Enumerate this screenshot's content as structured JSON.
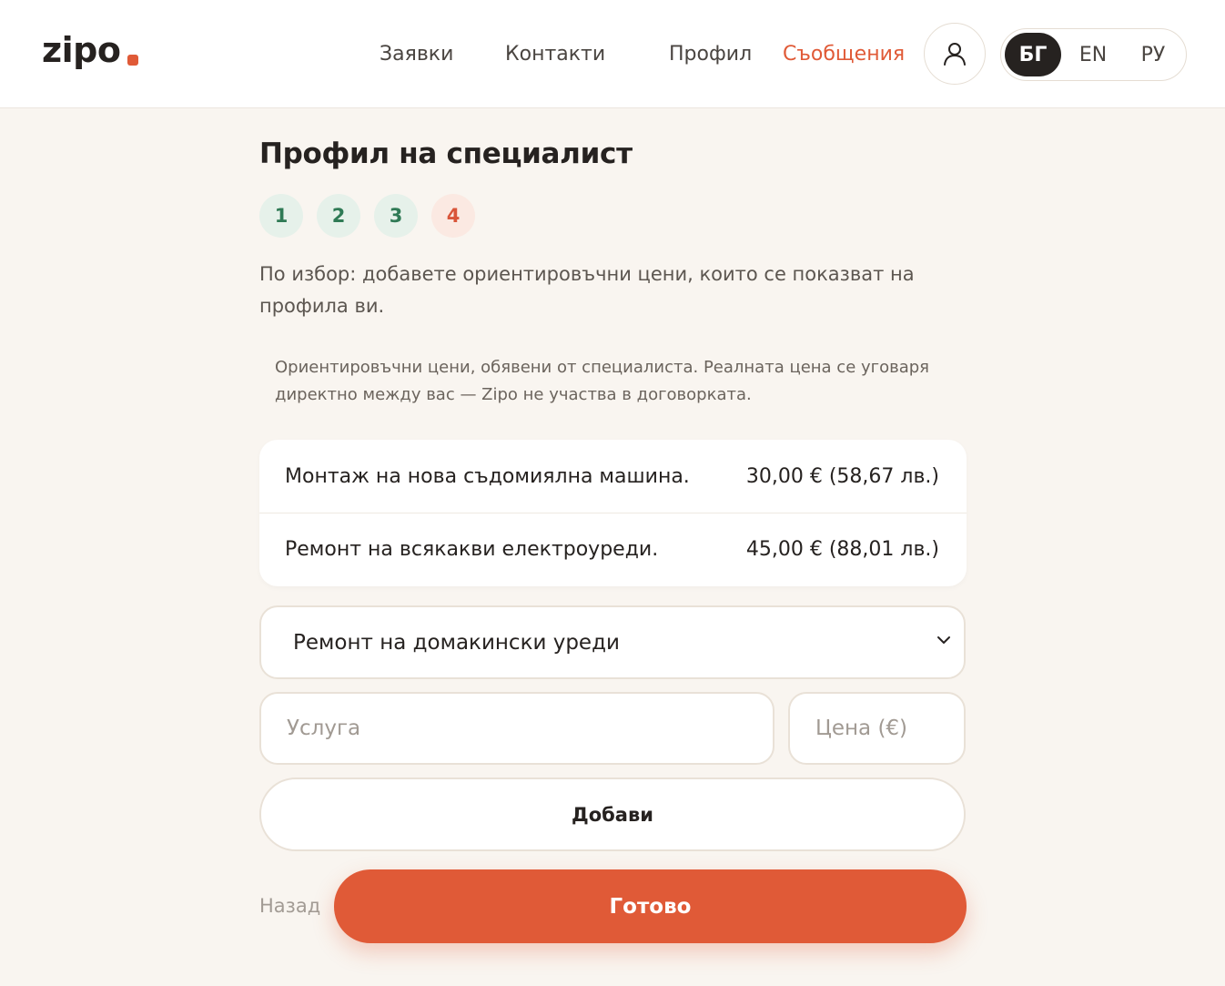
{
  "brand": {
    "logo_text": "zipo",
    "accent_color": "#e05a37"
  },
  "nav": {
    "items": [
      {
        "label": "Заявки",
        "active": false
      },
      {
        "label": "Контакти",
        "active": false
      },
      {
        "label": "Профил",
        "active": false
      },
      {
        "label": "Съобщения",
        "active": true
      }
    ],
    "user_icon": "user-icon"
  },
  "languages": {
    "options": [
      "БГ",
      "EN",
      "РУ"
    ],
    "selected": "БГ"
  },
  "page": {
    "title": "Профил на специалист",
    "steps": [
      {
        "label": "1",
        "state": "done"
      },
      {
        "label": "2",
        "state": "done"
      },
      {
        "label": "3",
        "state": "done"
      },
      {
        "label": "4",
        "state": "current"
      }
    ],
    "intro": "По избор: добавете ориентировъчни цени, които се показват на профила ви.",
    "note": "Ориентировъчни цени, обявени от специалиста. Реалната цена се уговаря директно между вас — Zipo не участва в договорката."
  },
  "prices": [
    {
      "service": "Монтаж на нова съдомиялна машина.",
      "amount": "30,00 € (58,67 лв.)"
    },
    {
      "service": "Ремонт на всякакви електроуреди.",
      "amount": "45,00 € (88,01 лв.)"
    }
  ],
  "form": {
    "category_selected": "Ремонт на домакински уреди",
    "service_placeholder": "Услуга",
    "price_placeholder": "Цена (€)",
    "add_label": "Добави"
  },
  "footer": {
    "back_label": "Назад",
    "done_label": "Готово"
  }
}
